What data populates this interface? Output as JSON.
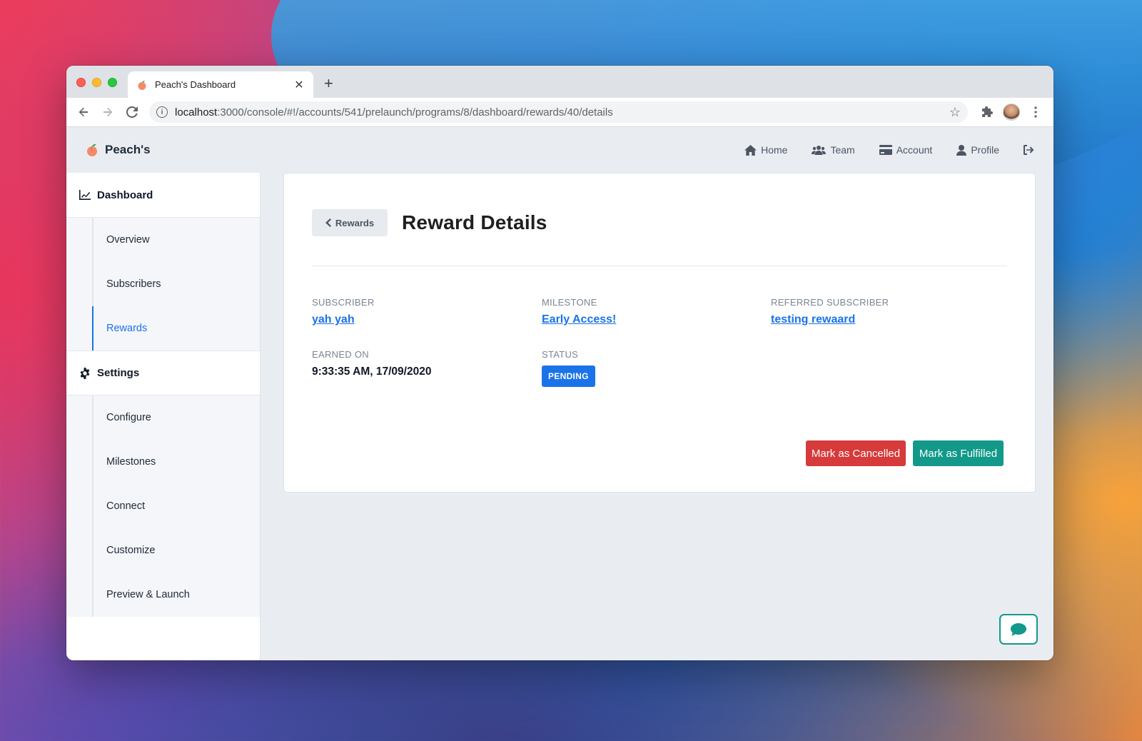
{
  "browser": {
    "tab_title": "Peach's Dashboard",
    "tab_close": "✕",
    "new_tab": "+",
    "url_host": "localhost",
    "url_path": ":3000/console/#!/accounts/541/prelaunch/programs/8/dashboard/rewards/40/details"
  },
  "brand": {
    "name": "Peach's"
  },
  "topnav": {
    "home": "Home",
    "team": "Team",
    "account": "Account",
    "profile": "Profile"
  },
  "sidebar": {
    "dashboard_label": "Dashboard",
    "dashboard_items": [
      "Overview",
      "Subscribers",
      "Rewards"
    ],
    "settings_label": "Settings",
    "settings_items": [
      "Configure",
      "Milestones",
      "Connect",
      "Customize",
      "Preview & Launch"
    ],
    "active_item": "Rewards"
  },
  "detail": {
    "back_label": "Rewards",
    "title": "Reward Details",
    "subscriber_label": "SUBSCRIBER",
    "subscriber_value": "yah yah",
    "milestone_label": "MILESTONE",
    "milestone_value": "Early Access!",
    "referred_label": "REFERRED SUBSCRIBER",
    "referred_value": "testing rewaard",
    "earned_label": "EARNED ON",
    "earned_value": "9:33:35 AM, 17/09/2020",
    "status_label": "STATUS",
    "status_value": "PENDING",
    "cancel_button": "Mark as Cancelled",
    "fulfill_button": "Mark as Fulfilled"
  },
  "colors": {
    "accent": "#1a73e8",
    "danger": "#d63a3a",
    "success": "#12998a"
  }
}
